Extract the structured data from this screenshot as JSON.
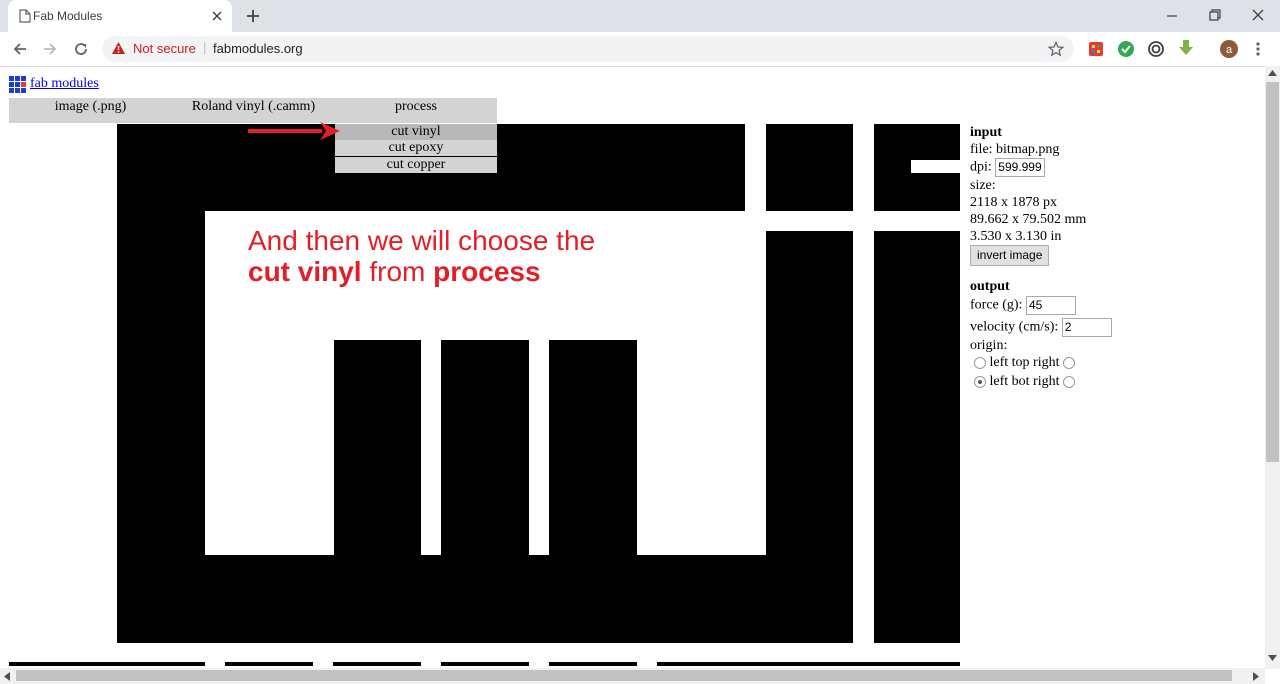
{
  "browser": {
    "tab_title": "Fab Modules",
    "not_secure": "Not secure",
    "url": "fabmodules.org"
  },
  "page": {
    "link_text": "fab modules",
    "menu": {
      "input_format": "image (.png)",
      "output_format": "Roland vinyl (.camm)",
      "process": "process",
      "process_options": [
        "cut vinyl",
        "cut epoxy",
        "cut copper"
      ],
      "selected_option": "cut vinyl"
    },
    "annotation": {
      "line1": "And then we will choose the",
      "line2_bold1": "cut vinyl",
      "line2_mid": " from ",
      "line2_bold2": "process"
    },
    "input": {
      "heading": "input",
      "file": "file: bitmap.png",
      "dpi_label": "dpi:",
      "dpi_value": "599.999",
      "size_label": "size:",
      "size_px": "2118 x 1878 px",
      "size_mm": "89.662 x 79.502 mm",
      "size_in": "3.530 x 3.130 in",
      "invert_button": "invert image"
    },
    "output": {
      "heading": "output",
      "force_label": "force (g):",
      "force_value": "45",
      "velocity_label": "velocity (cm/s):",
      "velocity_value": "2",
      "origin_label": "origin:",
      "origin_row1": "left top right",
      "origin_row2": "left bot right"
    }
  },
  "colors": {
    "annotation_red": "#e41e26",
    "link_blue": "#0000ee",
    "menu_gray": "#d3d3d3"
  }
}
